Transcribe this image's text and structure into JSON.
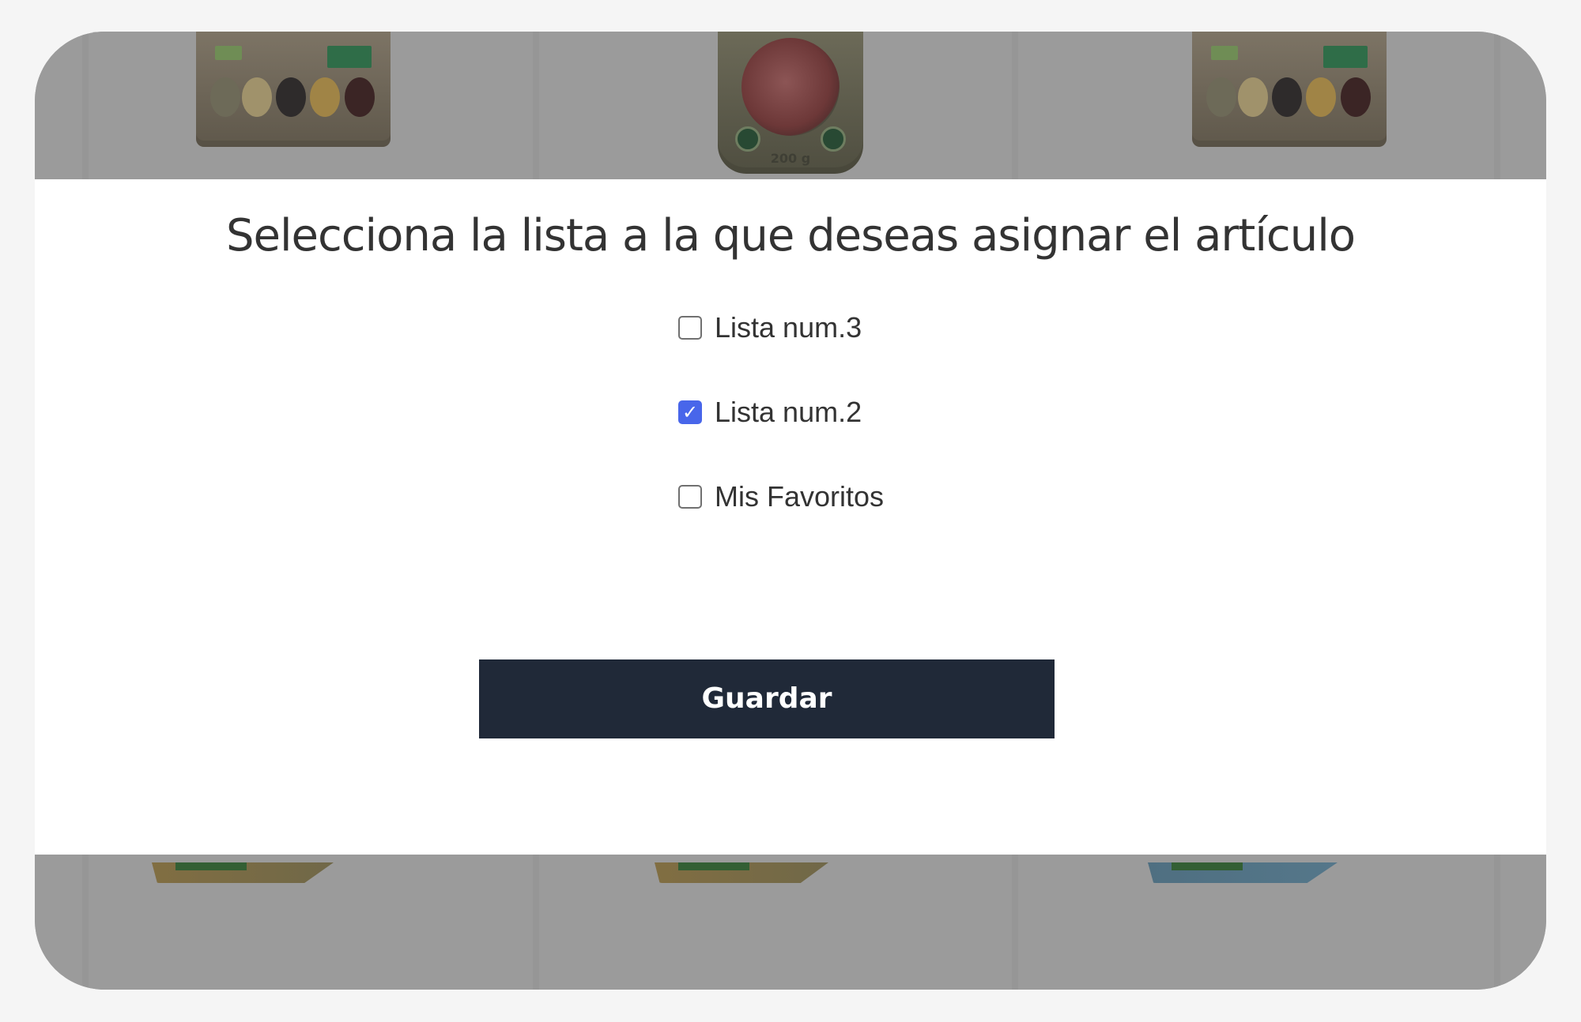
{
  "modal": {
    "title": "Selecciona la lista a la que deseas asignar el artículo",
    "options": [
      {
        "label": "Lista num.3",
        "checked": false
      },
      {
        "label": "Lista num.2",
        "checked": true
      },
      {
        "label": "Mis Favoritos",
        "checked": false
      }
    ],
    "save_label": "Guardar"
  },
  "background": {
    "product_weight": "200 g"
  },
  "icons": {
    "checkbox_checked": "checkmark-icon"
  },
  "colors": {
    "button_bg": "#202938",
    "checkbox_checked": "#4866ea",
    "overlay_bg": "#9b9b9b",
    "modal_bg": "#ffffff"
  }
}
